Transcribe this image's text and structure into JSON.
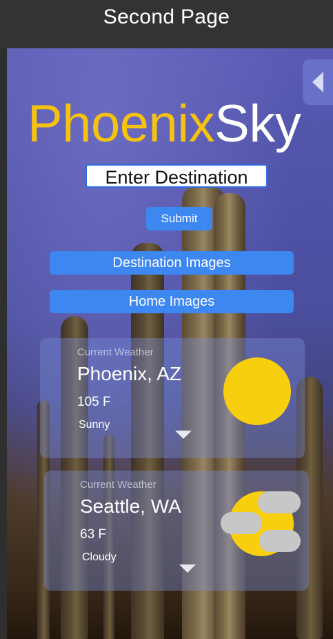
{
  "header": {
    "title": "Second Page"
  },
  "brand": {
    "part1": "Phoenix",
    "part2": "Sky"
  },
  "search": {
    "value": "Enter Destination"
  },
  "buttons": {
    "submit": "Submit",
    "destination_images": "Destination Images",
    "home_images": "Home Images"
  },
  "weather": [
    {
      "subtitle": "Current Weather",
      "city": "Phoenix, AZ",
      "temp": "105 F",
      "condition": "Sunny",
      "icon": "sun-icon"
    },
    {
      "subtitle": "Current Weather",
      "city": "Seattle, WA",
      "temp": "63 F",
      "condition": "Cloudy",
      "icon": "cloudy-icon"
    }
  ],
  "colors": {
    "brand_accent": "#f5c20f",
    "button": "#3d87f0",
    "sun": "#f8cf0e",
    "cloud": "#c7c7c7"
  }
}
